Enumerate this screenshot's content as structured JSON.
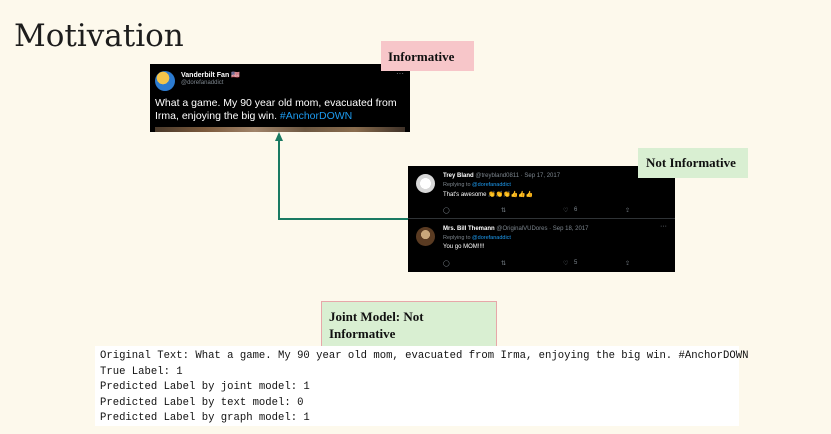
{
  "slide": {
    "title": "Motivation"
  },
  "labels": {
    "informative": "Informative",
    "not_informative": "Not Informative",
    "joint_line1": "Joint Model: Not",
    "joint_line2": "Informative"
  },
  "main_tweet": {
    "name": "Vanderbilt Fan 🇺🇸",
    "handle": "@dorefanaddict",
    "more": "···",
    "text": "What a game. My 90 year old mom, evacuated from Irma, enjoying the big win. ",
    "hashtag": "#AnchorDOWN"
  },
  "replies": [
    {
      "name": "Trey Bland",
      "meta": "@treybland0811 · Sep 17, 2017",
      "replying_prefix": "Replying to ",
      "replying_handle": "@dorefanaddict",
      "body": "That's awesome 👏👏👏👍👍👍",
      "like_count": "6",
      "more": "···"
    },
    {
      "name": "Mrs. Bill Themann",
      "meta": "@OriginalVUDores · Sep 18, 2017",
      "replying_prefix": "Replying to ",
      "replying_handle": "@dorefanaddict",
      "body": "You go MOM!!!!",
      "like_count": "5",
      "more": "···"
    }
  ],
  "action_icons": [
    "reply-icon",
    "retweet-icon",
    "like-icon",
    "share-icon"
  ],
  "console": {
    "line1": "Original Text: What a game. My 90 year old mom, evacuated from Irma, enjoying the big win. #AnchorDOWN",
    "line2": "True Label: 1",
    "line3": "Predicted Label by joint model: 1",
    "line4": "Predicted Label by text model: 0",
    "line5": "Predicted Label by graph model: 1"
  },
  "colors": {
    "background": "#fdf9ec",
    "informative_tag": "#f7c6c9",
    "not_informative_tag": "#d9efd2",
    "arrow": "#1a7a62",
    "twitter_link": "#1d9bf0"
  }
}
